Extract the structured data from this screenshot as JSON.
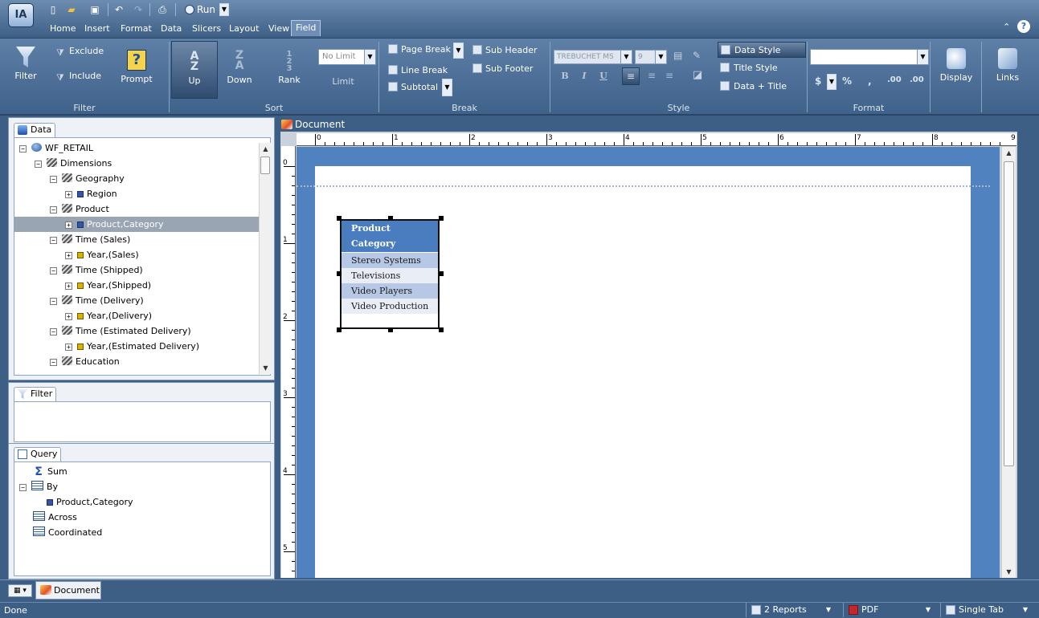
{
  "quick_access": {
    "run_label": "Run"
  },
  "app_logo": "IA",
  "menu_tabs": [
    "Home",
    "Insert",
    "Format",
    "Data",
    "Slicers",
    "Layout",
    "View",
    "Field"
  ],
  "ribbon": {
    "filter_group": {
      "label": "Filter",
      "filter_button": "Filter",
      "exclude_button": "Exclude",
      "include_button": "Include",
      "prompt_button": "Prompt"
    },
    "sort_group": {
      "label": "Sort",
      "up_button": "Up",
      "down_button": "Down",
      "rank_button": "Rank",
      "limit_button": "Limit",
      "limit_value": "No Limit"
    },
    "break_group": {
      "label": "Break",
      "page_break": "Page Break",
      "line_break": "Line Break",
      "subtotal": "Subtotal",
      "sub_header": "Sub Header",
      "sub_footer": "Sub Footer"
    },
    "style_group": {
      "label": "Style",
      "font": "TREBUCHET MS",
      "size": "9",
      "bold": "B",
      "italic": "I",
      "underline": "U",
      "data_style": "Data Style",
      "title_style": "Title Style",
      "data_title": "Data + Title"
    },
    "format_group": {
      "label": "Format",
      "currency": "$",
      "percent": "%",
      "comma": ",",
      "inc_decimal": ".00",
      "dec_decimal": ".00"
    },
    "display_button": "Display",
    "links_button": "Links"
  },
  "data_panel": {
    "title": "Data",
    "tree": [
      {
        "label": "WF_RETAIL",
        "level": 0,
        "icon": "database-icon",
        "expander": "−"
      },
      {
        "label": "Dimensions",
        "level": 1,
        "icon": "dimension-icon",
        "expander": "−"
      },
      {
        "label": "Geography",
        "level": 2,
        "icon": "dimension-icon",
        "expander": "−"
      },
      {
        "label": "Region",
        "level": 3,
        "icon": "field-blue-icon",
        "expander": "+"
      },
      {
        "label": "Product",
        "level": 2,
        "icon": "dimension-icon",
        "expander": "−"
      },
      {
        "label": "Product,Category",
        "level": 3,
        "icon": "field-blue-icon",
        "expander": "+",
        "selected": true
      },
      {
        "label": "Time (Sales)",
        "level": 2,
        "icon": "dimension-icon",
        "expander": "−"
      },
      {
        "label": "Year,(Sales)",
        "level": 3,
        "icon": "field-yellow-icon",
        "expander": "+"
      },
      {
        "label": "Time (Shipped)",
        "level": 2,
        "icon": "dimension-icon",
        "expander": "−"
      },
      {
        "label": "Year,(Shipped)",
        "level": 3,
        "icon": "field-yellow-icon",
        "expander": "+"
      },
      {
        "label": "Time (Delivery)",
        "level": 2,
        "icon": "dimension-icon",
        "expander": "−"
      },
      {
        "label": "Year,(Delivery)",
        "level": 3,
        "icon": "field-yellow-icon",
        "expander": "+"
      },
      {
        "label": "Time (Estimated Delivery)",
        "level": 2,
        "icon": "dimension-icon",
        "expander": "−"
      },
      {
        "label": "Year,(Estimated Delivery)",
        "level": 3,
        "icon": "field-yellow-icon",
        "expander": "+"
      },
      {
        "label": "Education",
        "level": 2,
        "icon": "dimension-icon",
        "expander": "−"
      }
    ]
  },
  "filter_panel": {
    "title": "Filter"
  },
  "query_panel": {
    "title": "Query",
    "items": [
      {
        "label": "Sum",
        "icon": "sum-icon",
        "indent": 1
      },
      {
        "label": "By",
        "icon": "grid-icon",
        "indent": 0,
        "expander": "−"
      },
      {
        "label": "Product,Category",
        "icon": "field-blue-icon",
        "indent": 2
      },
      {
        "label": "Across",
        "icon": "grid-icon",
        "indent": 1
      },
      {
        "label": "Coordinated",
        "icon": "grid-icon",
        "indent": 1
      }
    ]
  },
  "document": {
    "title": "Document",
    "ruler_h": [
      "0",
      "1",
      "2",
      "3",
      "4",
      "5",
      "6",
      "7",
      "8",
      "9"
    ],
    "ruler_v": [
      "0",
      "1",
      "2",
      "3",
      "4",
      "5"
    ],
    "report": {
      "header_line1": "Product",
      "header_line2": "Category",
      "rows": [
        "Stereo Systems",
        "Televisions",
        "Video Players",
        "Video Production"
      ]
    }
  },
  "bottom_tabs": {
    "document_tab": "Document"
  },
  "status": {
    "text": "Done",
    "reports": "2 Reports",
    "output": "PDF",
    "tab_mode": "Single Tab"
  }
}
